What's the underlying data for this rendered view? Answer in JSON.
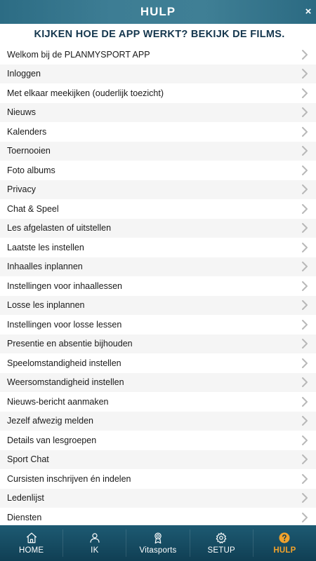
{
  "header": {
    "title": "HULP",
    "close_glyph": "×"
  },
  "intro": {
    "text": "KIJKEN HOE DE APP WERKT? BEKIJK DE FILMS."
  },
  "videos": [
    "Welkom bij de PLANMYSPORT APP",
    "Inloggen",
    "Met elkaar meekijken (ouderlijk toezicht)",
    "Nieuws",
    "Kalenders",
    "Toernooien",
    "Foto albums",
    "Privacy",
    "Chat & Speel",
    "Les afgelasten of uitstellen",
    "Laatste les instellen",
    "Inhaalles inplannen",
    "Instellingen voor inhaallessen",
    "Losse les inplannen",
    "Instellingen voor losse lessen",
    "Presentie en absentie bijhouden",
    "Speelomstandigheid instellen",
    "Weersomstandigheid instellen",
    "Nieuws-bericht aanmaken",
    "Jezelf afwezig melden",
    "Details van lesgroepen",
    "Sport Chat",
    "Cursisten inschrijven én indelen",
    "Ledenlijst",
    "Diensten"
  ],
  "tabbar": {
    "tabs": [
      {
        "label": "HOME",
        "icon": "home-icon"
      },
      {
        "label": "IK",
        "icon": "user-icon"
      },
      {
        "label": "Vitasports",
        "icon": "award-icon"
      },
      {
        "label": "SETUP",
        "icon": "gear-icon"
      },
      {
        "label": "HULP",
        "icon": "help-icon"
      }
    ],
    "active": "HULP",
    "active_color": "#f0a22c"
  },
  "colors": {
    "header_bg": "#3d7d94",
    "tabbar_bg": "#103f54",
    "intro_text": "#14364d",
    "chevron": "#b8b8b8"
  }
}
